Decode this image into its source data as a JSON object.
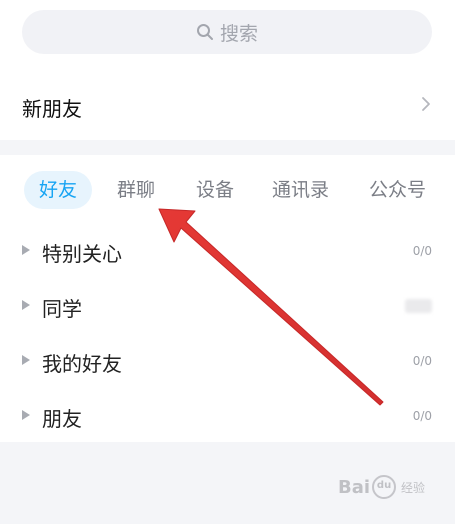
{
  "search": {
    "placeholder": "搜索",
    "icon": "search-icon"
  },
  "new_friends": {
    "label": "新朋友",
    "chevron_icon": "chevron-right-icon"
  },
  "tabs": [
    {
      "label": "好友",
      "active": true
    },
    {
      "label": "群聊",
      "active": false
    },
    {
      "label": "设备",
      "active": false
    },
    {
      "label": "通讯录",
      "active": false
    },
    {
      "label": "公众号",
      "active": false
    }
  ],
  "groups": [
    {
      "name": "特别关心",
      "count": "0/0"
    },
    {
      "name": "同学",
      "count": ""
    },
    {
      "name": "我的好友",
      "count": "0/0"
    },
    {
      "name": "朋友",
      "count": "0/0"
    }
  ],
  "colors": {
    "accent": "#17a4f3",
    "active_tab_bg": "#e7f4fd",
    "annotation_arrow": "#e53935"
  },
  "watermark": {
    "brand_left": "Bai",
    "brand_paw": "du",
    "brand_right": "经验"
  }
}
